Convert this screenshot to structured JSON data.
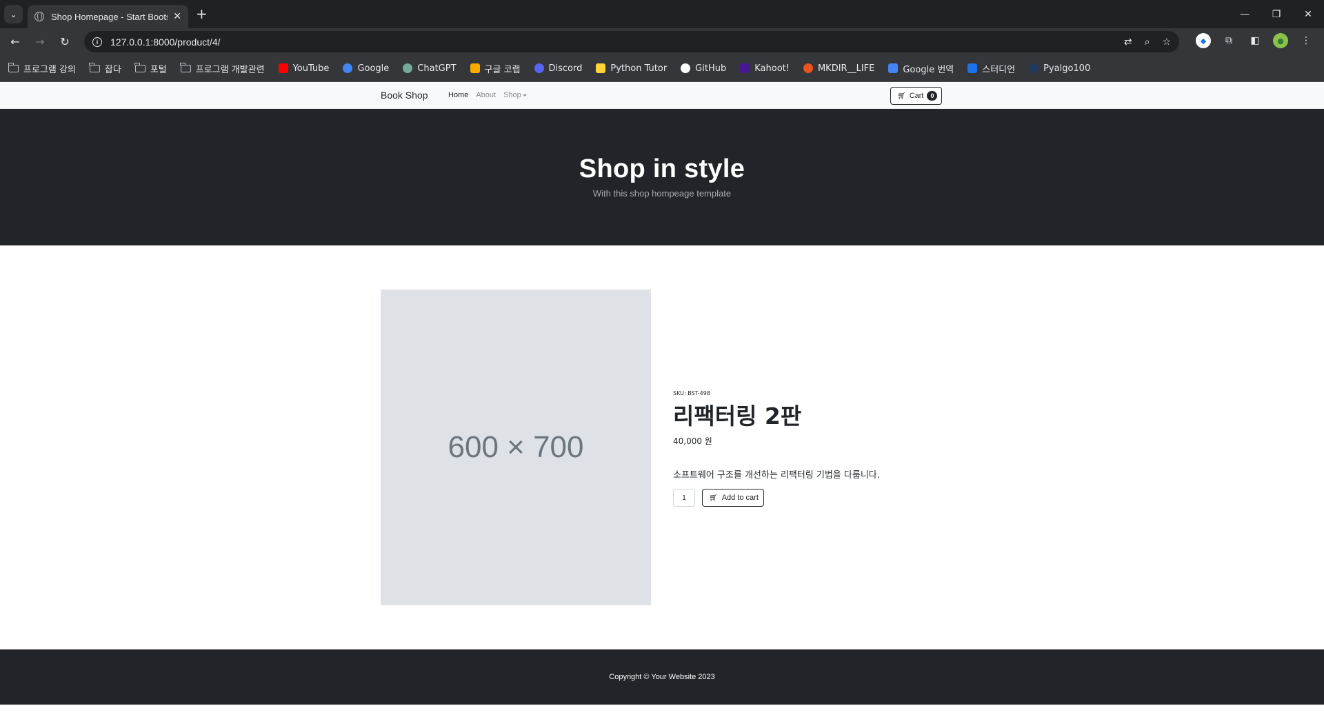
{
  "browser": {
    "tab_title": "Shop Homepage - Start Bootstrap",
    "url": "127.0.0.1:8000/product/4/",
    "bookmarks": [
      {
        "label": "프로그램 강의",
        "icon": "folder-icon"
      },
      {
        "label": "잡다",
        "icon": "folder-icon"
      },
      {
        "label": "포털",
        "icon": "folder-icon"
      },
      {
        "label": "프로그램 개발관련",
        "icon": "folder-icon"
      },
      {
        "label": "YouTube",
        "icon": "youtube-icon",
        "color": "#ff0000"
      },
      {
        "label": "Google",
        "icon": "google-icon",
        "color": "#4285f4"
      },
      {
        "label": "ChatGPT",
        "icon": "chatgpt-icon",
        "color": "#74aa9c"
      },
      {
        "label": "구글 코랩",
        "icon": "colab-icon",
        "color": "#f9ab00"
      },
      {
        "label": "Discord",
        "icon": "discord-icon",
        "color": "#5865f2"
      },
      {
        "label": "Python Tutor",
        "icon": "python-icon",
        "color": "#ffd43b"
      },
      {
        "label": "GitHub",
        "icon": "github-icon",
        "color": "#ffffff"
      },
      {
        "label": "Kahoot!",
        "icon": "kahoot-icon",
        "color": "#46178f"
      },
      {
        "label": "MKDIR__LIFE",
        "icon": "tistory-icon",
        "color": "#eb531f"
      },
      {
        "label": "Google 번역",
        "icon": "translate-icon",
        "color": "#4285f4"
      },
      {
        "label": "스터디언",
        "icon": "studyan-icon",
        "color": "#1a73e8"
      },
      {
        "label": "Pyalgo100",
        "icon": "pyalgo-icon",
        "color": "#1e3a5f"
      }
    ]
  },
  "navbar": {
    "brand": "Book Shop",
    "links": [
      "Home",
      "About",
      "Shop"
    ],
    "cart_label": "Cart",
    "cart_count": "0"
  },
  "hero": {
    "title": "Shop in style",
    "subtitle": "With this shop hompeage template"
  },
  "product": {
    "image_placeholder": "600 × 700",
    "sku": "SKU: BST-498",
    "title": "리팩터링 2판",
    "price": "40,000 원",
    "description": "소프트웨어 구조를 개선하는 리팩터링 기법을 다룹니다.",
    "quantity": "1",
    "add_to_cart_label": "Add to cart"
  },
  "footer": {
    "copyright": "Copyright © Your Website 2023"
  },
  "colors": {
    "dark": "#212529",
    "light_bg": "#f8f9fa",
    "placeholder_bg": "#dee2e6"
  }
}
